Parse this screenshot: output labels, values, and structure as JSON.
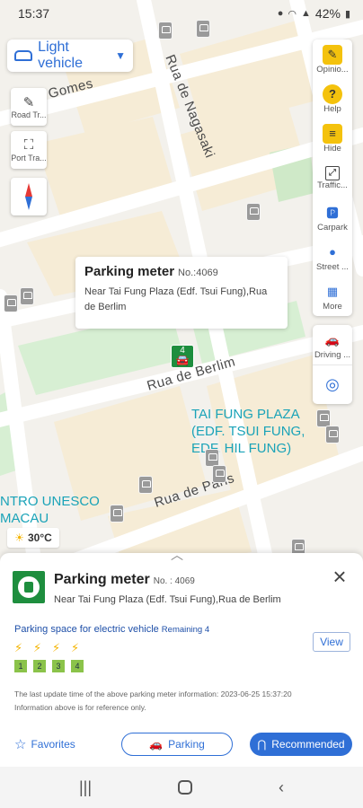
{
  "status_bar": {
    "time": "15:37",
    "battery": "42%"
  },
  "vehicle_selector": {
    "label": "Light vehicle"
  },
  "map": {
    "streets": {
      "gomes": "a Gomes",
      "nagasaki": "Rua de Nagasaki",
      "berlim": "Rua de Berlim",
      "paris": "Rua de Paris"
    },
    "poi_tai_fung": [
      "TAI FUNG PLAZA",
      "(EDF. TSUI FUNG,",
      "EDF. HIL FUNG)"
    ],
    "poi_unesco": [
      "NTRO UNESCO",
      "MACAU"
    ],
    "marker_count": "4",
    "weather": "30°C"
  },
  "left_tools": {
    "road_traffic": "Road Tr...",
    "port_traffic": "Port Tra..."
  },
  "right_tools": [
    {
      "label": "Opinio...",
      "icon": "pencil-icon"
    },
    {
      "label": "Help",
      "icon": "question-icon"
    },
    {
      "label": "Hide",
      "icon": "layers-icon"
    },
    {
      "label": "Traffic...",
      "icon": "traffic-icon"
    },
    {
      "label": "Carpark",
      "icon": "car-park-icon"
    },
    {
      "label": "Street ...",
      "icon": "street-icon"
    },
    {
      "label": "More",
      "icon": "grid-icon"
    }
  ],
  "right_tools_2": {
    "driving": "Driving ..."
  },
  "popup": {
    "title": "Parking meter",
    "number": "No.:4069",
    "address": "Near Tai Fung Plaza (Edf. Tsui Fung),Rua de Berlim"
  },
  "sheet": {
    "title": "Parking meter",
    "number": "No. : 4069",
    "address": "Near Tai Fung Plaza (Edf. Tsui Fung),Rua de Berlim",
    "ev_title": "Parking space for electric vehicle",
    "ev_remaining": "Remaining 4",
    "slots": [
      "1",
      "2",
      "3",
      "4"
    ],
    "view_label": "View",
    "update_note_1": "The last update time of the above parking meter information: 2023-06-25 15:37:20",
    "update_note_2": "Information above is for reference only.",
    "favorites_label": "Favorites",
    "parking_label": "Parking",
    "recommended_label": "Recommended"
  },
  "colors": {
    "accent": "#2f6fd6",
    "green": "#1e8e3e",
    "poi": "#1aa3b8"
  }
}
